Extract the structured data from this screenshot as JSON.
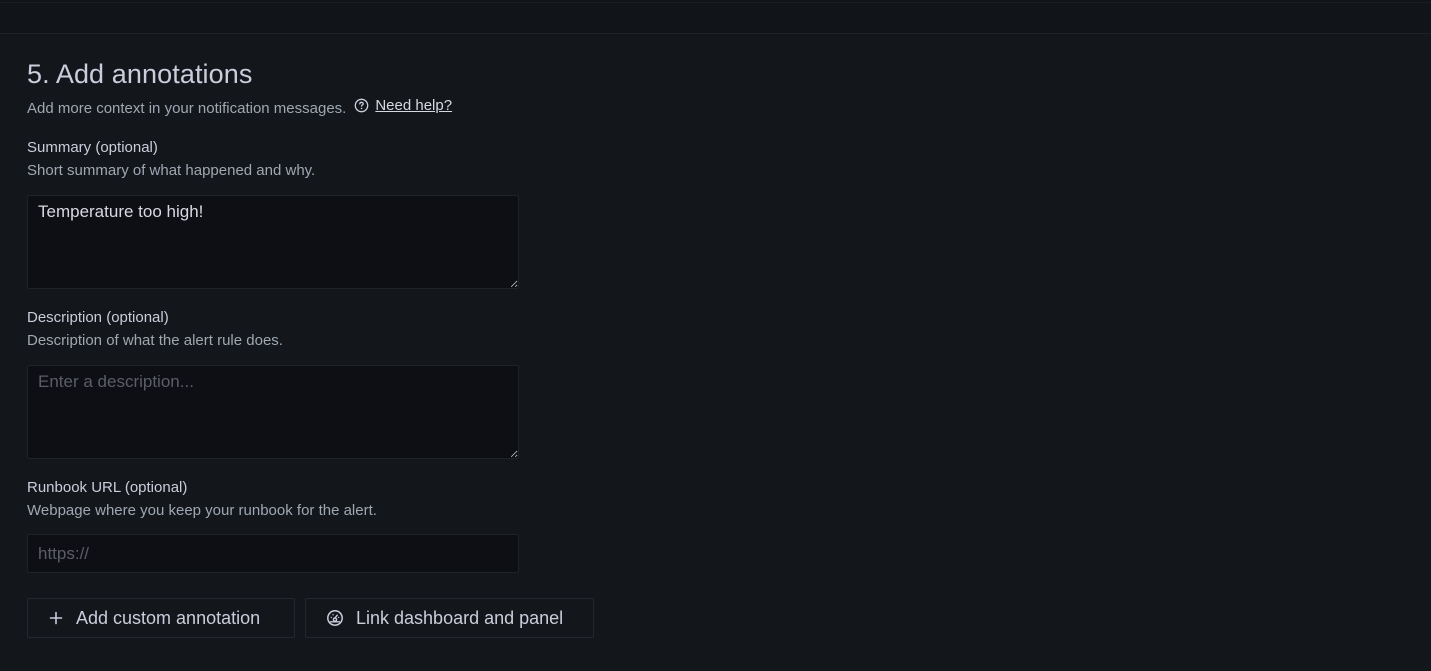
{
  "section": {
    "title": "5. Add annotations",
    "subtitle": "Add more context in your notification messages.",
    "help_link": "Need help?"
  },
  "fields": {
    "summary": {
      "label": "Summary (optional)",
      "description": "Short summary of what happened and why.",
      "value": "Temperature too high!",
      "placeholder": ""
    },
    "description": {
      "label": "Description (optional)",
      "description": "Description of what the alert rule does.",
      "value": "",
      "placeholder": "Enter a description..."
    },
    "runbook": {
      "label": "Runbook URL (optional)",
      "description": "Webpage where you keep your runbook for the alert.",
      "value": "",
      "placeholder": "https://"
    }
  },
  "actions": {
    "add_custom_annotation": "Add custom annotation",
    "link_dashboard_panel": "Link dashboard and panel"
  },
  "icons": {
    "help": "question-circle-icon",
    "add": "plus-icon",
    "link_dashboard": "dashboard-gauge-icon"
  },
  "colors": {
    "background": "#111217",
    "panel": "#13171b",
    "input_background": "#0e0f14",
    "text_primary": "#ccccdc",
    "text_secondary": "#9fa7b3",
    "placeholder": "#5b5e66"
  }
}
